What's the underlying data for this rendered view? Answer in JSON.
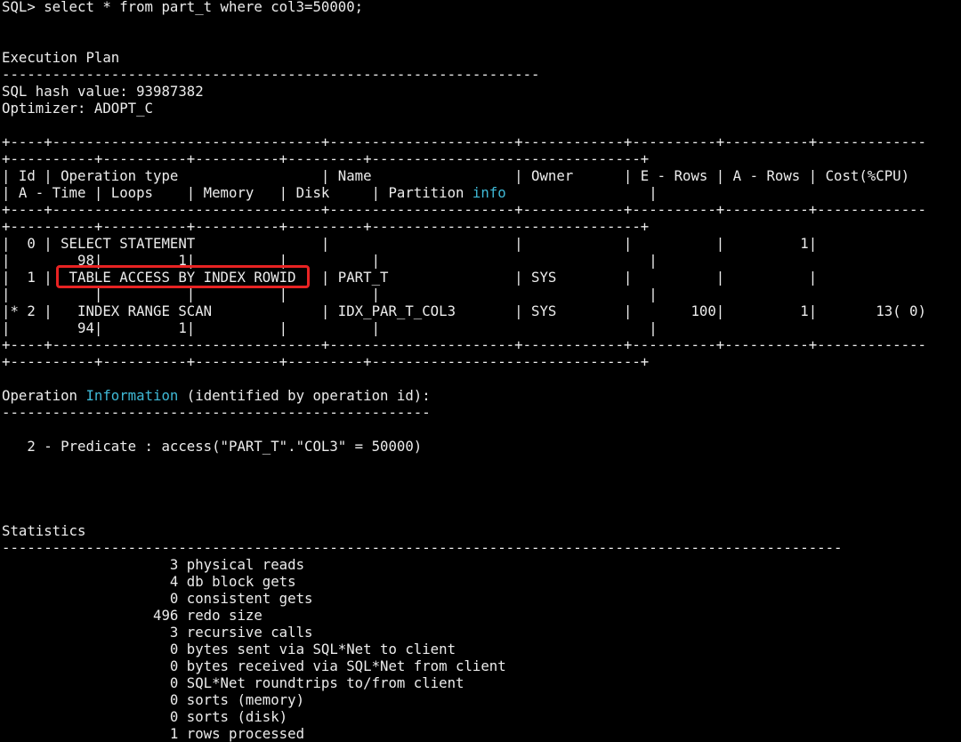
{
  "terminal": {
    "lines": [
      "SQL> select * from part_t where col3=50000;",
      "",
      "",
      "Execution Plan",
      "----------------------------------------------------------------",
      "SQL hash value: 93987382",
      "Optimizer: ADOPT_C",
      "",
      "+----+--------------------------------+----------------------+------------+----------+----------+-------------",
      "+----------+----------+----------+---------+--------------------------------+",
      "| Id | Operation type                 | Name                 | Owner      | E - Rows | A - Rows | Cost(%CPU)",
      "| A - Time | Loops    | Memory   | Disk     | Partition info                 |",
      "+----+--------------------------------+----------------------+------------+----------+----------+-------------",
      "+----------+----------+----------+---------+--------------------------------+",
      "|  0 | SELECT STATEMENT               |                      |            |          |         1|",
      "|        98|         1|          |          |                                |",
      "|  1 |  TABLE ACCESS BY INDEX ROWID   | PART_T               | SYS        |          |          |",
      "|          |          |          |          |                                |",
      "|* 2 |   INDEX RANGE SCAN             | IDX_PAR_T_COL3       | SYS        |       100|         1|       13( 0)",
      "|        94|         1|          |          |                                |",
      "+----+--------------------------------+----------------------+------------+----------+----------+-------------",
      "+----------+----------+----------+---------+--------------------------------+",
      "",
      "Operation Information (identified by operation id):",
      "---------------------------------------------------",
      "",
      "   2 - Predicate : access(\"PART_T\".\"COL3\" = 50000)",
      "",
      "",
      "",
      "",
      "Statistics",
      "----------------------------------------------------------------------------------------------------",
      "                    3 physical reads",
      "                    4 db block gets",
      "                    0 consistent gets",
      "                  496 redo size",
      "                    3 recursive calls",
      "                    0 bytes sent via SQL*Net to client",
      "                    0 bytes received via SQL*Net from client",
      "                    0 SQL*Net roundtrips to/from client",
      "                    0 sorts (memory)",
      "                    0 sorts (disk)",
      "                    1 rows processed"
    ],
    "highlight_color": "#3fb9d6",
    "box_color": "#e82323"
  }
}
